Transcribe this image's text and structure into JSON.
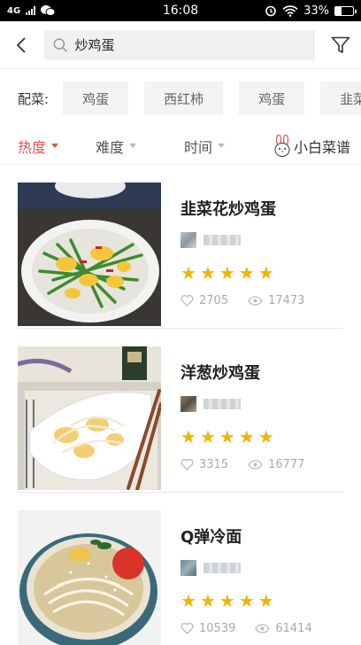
{
  "status_bar": {
    "network": "4G",
    "time": "16:08",
    "battery": "33%",
    "battery_level": 0.33
  },
  "search": {
    "query": "炒鸡蛋"
  },
  "ingredients": {
    "label": "配菜:",
    "chips": [
      "鸡蛋",
      "西红柿",
      "鸡蛋",
      "韭菜花"
    ]
  },
  "sort": {
    "items": [
      "热度",
      "难度",
      "时间"
    ],
    "active": "热度",
    "beginner_label": "小白菜谱"
  },
  "recipes": [
    {
      "title": "韭菜花炒鸡蛋",
      "rating": 5,
      "likes": "2705",
      "views": "17473"
    },
    {
      "title": "洋葱炒鸡蛋",
      "rating": 5,
      "likes": "3315",
      "views": "16777"
    },
    {
      "title": "Q弹冷面",
      "rating": 5,
      "likes": "10539",
      "views": "61414"
    }
  ],
  "colors": {
    "accent": "#e05550",
    "star": "#f5b400"
  }
}
